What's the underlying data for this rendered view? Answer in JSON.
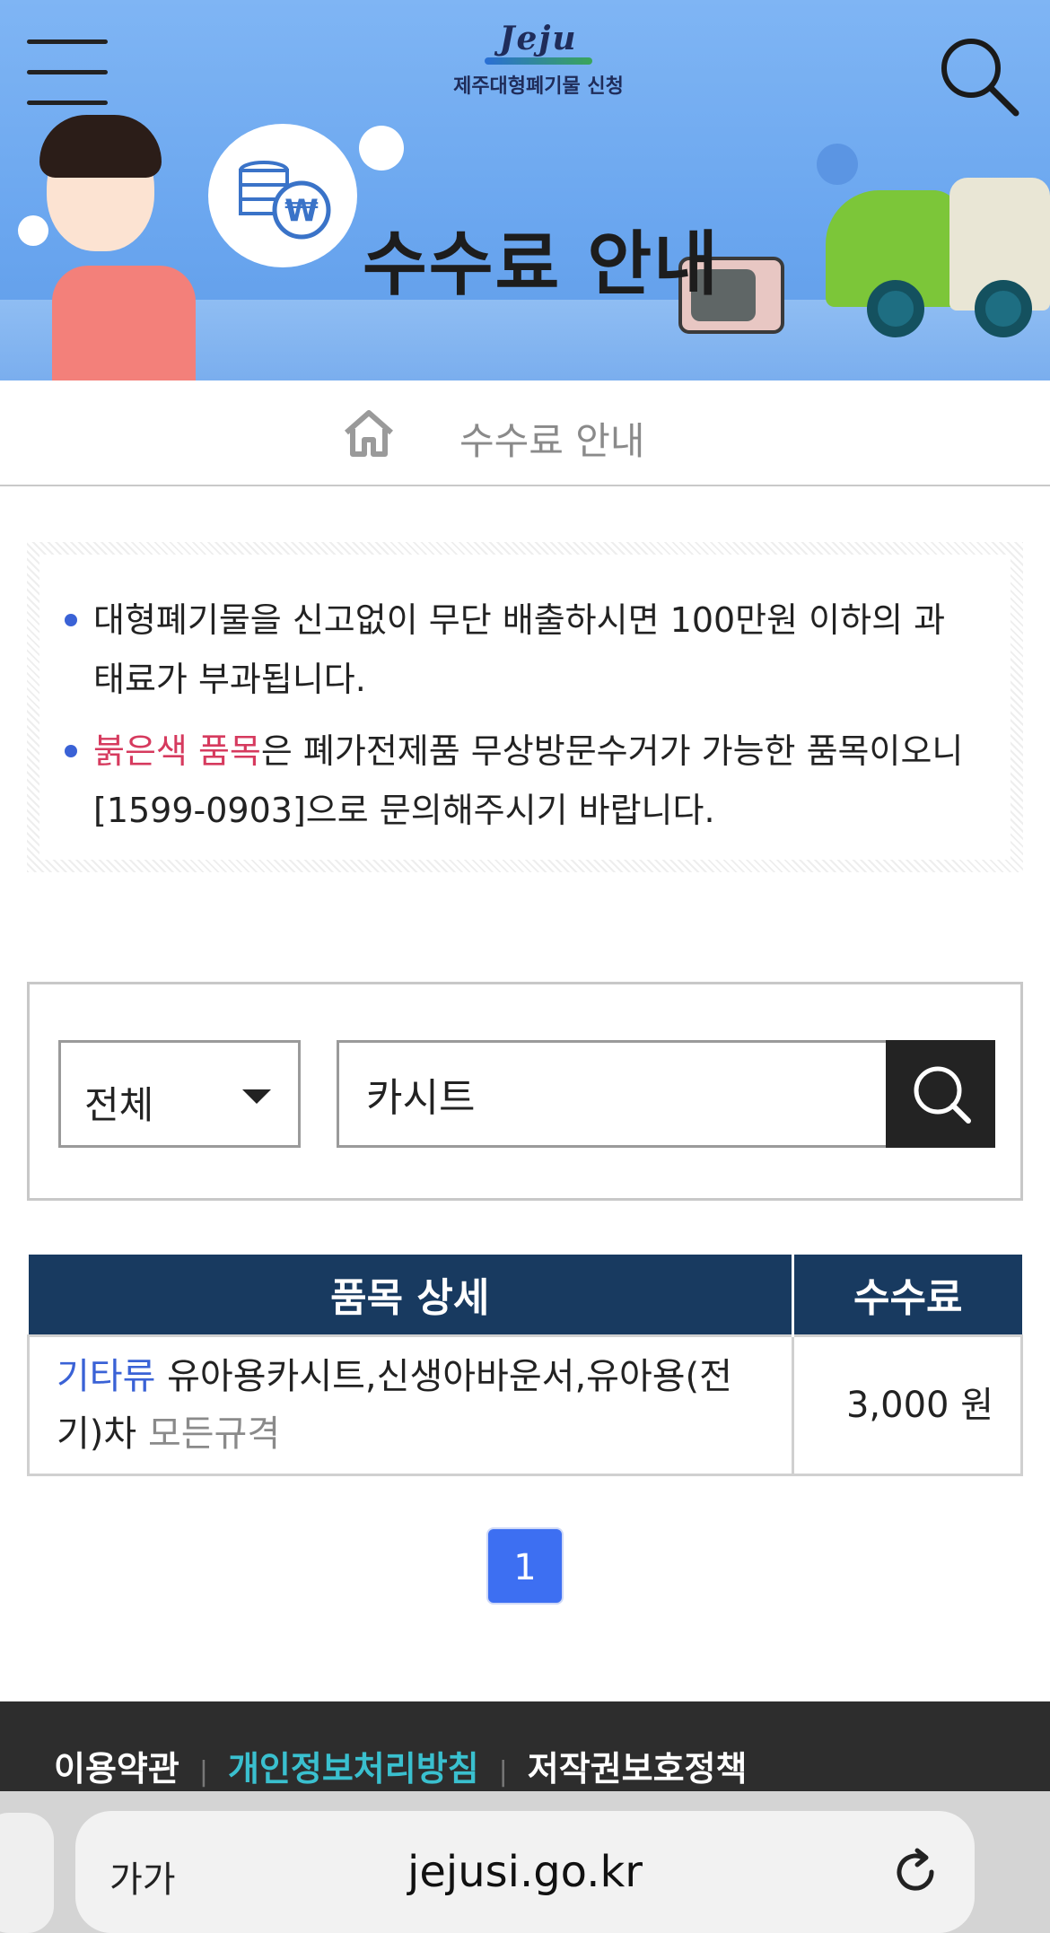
{
  "header": {
    "logo_mark": "Jeju",
    "logo_text": "제주대형폐기물 신청",
    "banner_title": "수수료 안내"
  },
  "breadcrumb": {
    "current": "수수료 안내"
  },
  "notice": {
    "item1": "대형폐기물을 신고없이 무단 배출하시면 100만원 이하의 과태료가 부과됩니다.",
    "item2_highlight": "붉은색 품목",
    "item2_rest": "은 폐가전제품 무상방문수거가 가능한 품목이오니 [1599-0903]으로 문의해주시기 바랍니다.",
    "highlight_color": "#d63a5e",
    "bullet_color": "#3a62d6"
  },
  "search": {
    "category_selected": "전체",
    "query": "카시트"
  },
  "table": {
    "headers": [
      "품목 상세",
      "수수료"
    ],
    "rows": [
      {
        "category": "기타류",
        "items": "유아용카시트,신생아바운서,유아용(전기)차",
        "spec": "모든규격",
        "fee": "3,000 원"
      }
    ],
    "header_color": "#183a60"
  },
  "pagination": {
    "current_page": "1"
  },
  "footer": {
    "links": [
      "이용약관",
      "개인정보처리방침",
      "저작권보호정책"
    ]
  },
  "browser": {
    "text_size_label": "가가",
    "url": "jejusi.go.kr"
  }
}
